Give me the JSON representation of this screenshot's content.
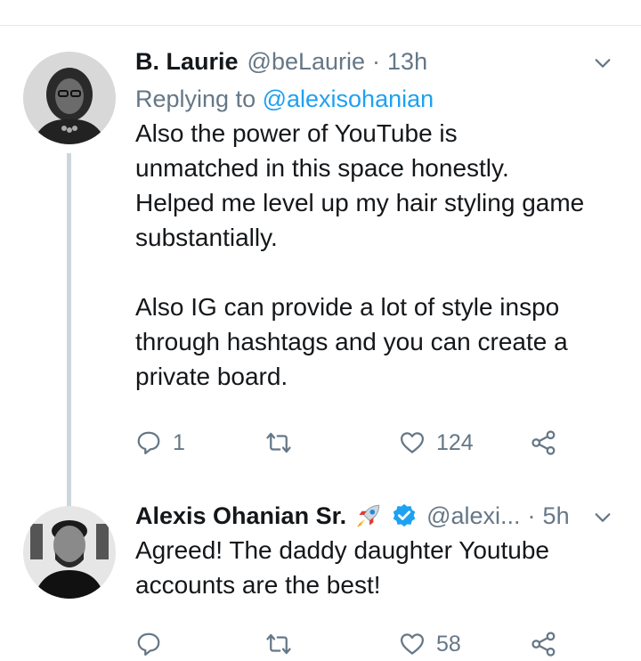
{
  "tweets": [
    {
      "name": "B. Laurie",
      "handle": "@beLaurie",
      "separator": "·",
      "time": "13h",
      "replying_prefix": "Replying to ",
      "replying_handle": "@alexisohanian",
      "body": "Also the power of YouTube is\nunmatched in this space honestly.\nHelped me level up my hair styling game\nsubstantially.\n\nAlso IG can provide a lot of style inspo\nthrough hashtags and you can create a\nprivate board.",
      "reply_count": "1",
      "retweet_count": "",
      "like_count": "124"
    },
    {
      "name": "Alexis Ohanian Sr.",
      "handle": "@alexi...",
      "separator": "·",
      "time": "5h",
      "body": "Agreed! The daddy daughter Youtube\naccounts are the best!",
      "reply_count": "",
      "retweet_count": "",
      "like_count": "58"
    }
  ],
  "icons": {
    "reply": "reply-icon",
    "retweet": "retweet-icon",
    "like": "heart-icon",
    "share": "share-icon",
    "menu": "chevron-down-icon",
    "verified": "verified-badge-icon",
    "emoji": "rocket-emoji"
  },
  "colors": {
    "text": "#14171a",
    "muted": "#657786",
    "link": "#1da1f2",
    "thread_line": "#ccd6dd",
    "verified": "#1da1f2"
  }
}
